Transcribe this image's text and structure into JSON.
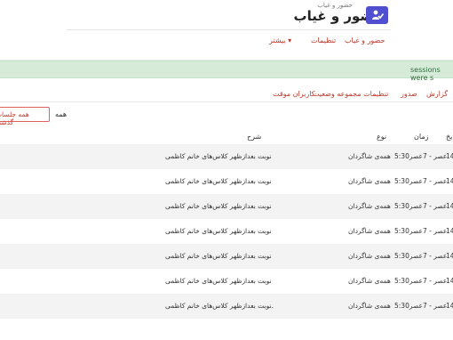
{
  "header": {
    "title": "حضور و غیاب",
    "subtitle": "حضور و غیاب",
    "icon": "attendance-icon",
    "accent": "#4f4fcf"
  },
  "nav": {
    "items": [
      {
        "label": "حضور و غیاب"
      },
      {
        "label": "تنظیمات"
      },
      {
        "label": "بیشتر ▾"
      }
    ]
  },
  "alert": {
    "text": "sessions were s"
  },
  "tabs": {
    "items": [
      {
        "label": "گزارش"
      },
      {
        "label": "صدور"
      },
      {
        "label": "تنظیمات مجموعه وضعیت"
      },
      {
        "label": "کاربران موقت"
      }
    ]
  },
  "filter": {
    "label": "همه",
    "selected": "همه جلسات گذشته"
  },
  "table": {
    "headers": {
      "date": "یخ",
      "time": "زمان",
      "type": "نوع",
      "description": "شرح"
    },
    "rows": [
      {
        "date": "14",
        "time": "5:30عصر - 7عصر",
        "type": "همه‌ی شاگردان",
        "description": "نوبت بعدازظهر کلاس‌های خانم کاظمی"
      },
      {
        "date": "14",
        "time": "5:30عصر - 7عصر",
        "type": "همه‌ی شاگردان",
        "description": "نوبت بعدازظهر کلاس‌های خانم کاظمی"
      },
      {
        "date": "14",
        "time": "5:30عصر - 7عصر",
        "type": "همه‌ی شاگردان",
        "description": "نوبت بعدازظهر کلاس‌های خانم کاظمی"
      },
      {
        "date": "14",
        "time": "5:30عصر - 7عصر",
        "type": "همه‌ی شاگردان",
        "description": "نوبت بعدازظهر کلاس‌های خانم کاظمی"
      },
      {
        "date": "14",
        "time": "5:30عصر - 7عصر",
        "type": "همه‌ی شاگردان",
        "description": "نوبت بعدازظهر کلاس‌های خانم کاظمی"
      },
      {
        "date": "14",
        "time": "5:30عصر - 7عصر",
        "type": "همه‌ی شاگردان",
        "description": "نوبت بعدازظهر کلاس‌های خانم کاظمی"
      },
      {
        "date": "14",
        "time": "5:30عصر - 7عصر",
        "type": "همه‌ی شاگردان",
        "description": "نوبت بعدازظهر کلاس‌های خانم کاظمی."
      }
    ]
  }
}
